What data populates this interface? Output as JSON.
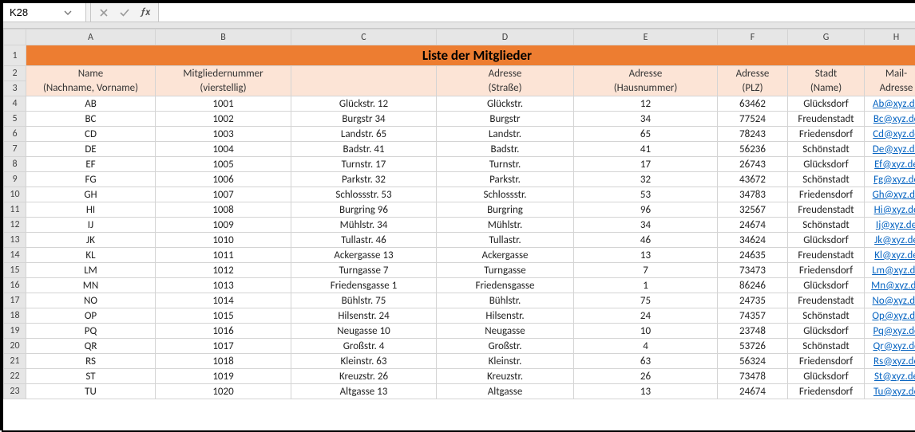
{
  "nameBox": {
    "value": "K28"
  },
  "formulaBar": {
    "value": ""
  },
  "columnLetters": [
    "A",
    "B",
    "C",
    "D",
    "E",
    "F",
    "G",
    "H"
  ],
  "title": "Liste der Mitglieder",
  "headers": {
    "A": {
      "top": "Name",
      "bot": "(Nachname, Vorname)"
    },
    "B": {
      "top": "Mitgliedernummer",
      "bot": "(vierstellig)"
    },
    "C": {
      "top": "",
      "bot": ""
    },
    "D": {
      "top": "Adresse",
      "bot": "(Straße)"
    },
    "E": {
      "top": "Adresse",
      "bot": "(Hausnummer)"
    },
    "F": {
      "top": "Adresse",
      "bot": "(PLZ)"
    },
    "G": {
      "top": "Stadt",
      "bot": "(Name)"
    },
    "H": {
      "top": "Mail-",
      "bot": "Adresse"
    }
  },
  "rows": [
    {
      "n": 4,
      "name": "AB",
      "num": "1001",
      "addr": "Glückstr. 12",
      "street": "Glückstr.",
      "house": "12",
      "plz": "63462",
      "city": "Glücksdorf",
      "mail": "Ab@xyz.de"
    },
    {
      "n": 5,
      "name": "BC",
      "num": "1002",
      "addr": "Burgstr 34",
      "street": "Burgstr",
      "house": "34",
      "plz": "77524",
      "city": "Freudenstadt",
      "mail": "Bc@xyz.de"
    },
    {
      "n": 6,
      "name": "CD",
      "num": "1003",
      "addr": "Landstr. 65",
      "street": "Landstr.",
      "house": "65",
      "plz": "78243",
      "city": "Friedensdorf",
      "mail": "Cd@xyz.de"
    },
    {
      "n": 7,
      "name": "DE",
      "num": "1004",
      "addr": "Badstr. 41",
      "street": "Badstr.",
      "house": "41",
      "plz": "56236",
      "city": "Schönstadt",
      "mail": "De@xyz.de"
    },
    {
      "n": 8,
      "name": "EF",
      "num": "1005",
      "addr": "Turnstr. 17",
      "street": "Turnstr.",
      "house": "17",
      "plz": "26743",
      "city": "Glücksdorf",
      "mail": "Ef@xyz.de"
    },
    {
      "n": 9,
      "name": "FG",
      "num": "1006",
      "addr": "Parkstr. 32",
      "street": "Parkstr.",
      "house": "32",
      "plz": "43672",
      "city": "Schönstadt",
      "mail": "Fg@xyz.de"
    },
    {
      "n": 10,
      "name": "GH",
      "num": "1007",
      "addr": "Schlossstr. 53",
      "street": "Schlossstr.",
      "house": "53",
      "plz": "34783",
      "city": "Friedensdorf",
      "mail": "Gh@xyz.de"
    },
    {
      "n": 11,
      "name": "HI",
      "num": "1008",
      "addr": "Burgring 96",
      "street": "Burgring",
      "house": "96",
      "plz": "32567",
      "city": "Freudenstadt",
      "mail": "Hi@xyz.de"
    },
    {
      "n": 12,
      "name": "IJ",
      "num": "1009",
      "addr": "Mühlstr. 34",
      "street": "Mühlstr.",
      "house": "34",
      "plz": "24674",
      "city": "Schönstadt",
      "mail": "Ij@xyz.de"
    },
    {
      "n": 13,
      "name": "JK",
      "num": "1010",
      "addr": "Tullastr. 46",
      "street": "Tullastr.",
      "house": "46",
      "plz": "34624",
      "city": "Glücksdorf",
      "mail": "Jk@xyz.de"
    },
    {
      "n": 14,
      "name": "KL",
      "num": "1011",
      "addr": "Ackergasse 13",
      "street": "Ackergasse",
      "house": "13",
      "plz": "24635",
      "city": "Freudenstadt",
      "mail": "Kl@xyz.de"
    },
    {
      "n": 15,
      "name": "LM",
      "num": "1012",
      "addr": "Turngasse 7",
      "street": "Turngasse",
      "house": "7",
      "plz": "73473",
      "city": "Friedensdorf",
      "mail": "Lm@xyz.de"
    },
    {
      "n": 16,
      "name": "MN",
      "num": "1013",
      "addr": "Friedensgasse 1",
      "street": "Friedensgasse",
      "house": "1",
      "plz": "86246",
      "city": "Glücksdorf",
      "mail": "Mn@xyz.de"
    },
    {
      "n": 17,
      "name": "NO",
      "num": "1014",
      "addr": "Bühlstr. 75",
      "street": "Bühlstr.",
      "house": "75",
      "plz": "24735",
      "city": "Freudenstadt",
      "mail": "No@xyz.de"
    },
    {
      "n": 18,
      "name": "OP",
      "num": "1015",
      "addr": "Hilsenstr. 24",
      "street": "Hilsenstr.",
      "house": "24",
      "plz": "74357",
      "city": "Schönstadt",
      "mail": "Op@xyz.de"
    },
    {
      "n": 19,
      "name": "PQ",
      "num": "1016",
      "addr": "Neugasse 10",
      "street": "Neugasse",
      "house": "10",
      "plz": "23748",
      "city": "Glücksdorf",
      "mail": "Pq@xyz.de"
    },
    {
      "n": 20,
      "name": "QR",
      "num": "1017",
      "addr": "Großstr. 4",
      "street": "Großstr.",
      "house": "4",
      "plz": "53726",
      "city": "Schönstadt",
      "mail": "Qr@xyz.de"
    },
    {
      "n": 21,
      "name": "RS",
      "num": "1018",
      "addr": "Kleinstr. 63",
      "street": "Kleinstr.",
      "house": "63",
      "plz": "56324",
      "city": "Friedensdorf",
      "mail": "Rs@xyz.de"
    },
    {
      "n": 22,
      "name": "ST",
      "num": "1019",
      "addr": "Kreuzstr. 26",
      "street": "Kreuzstr.",
      "house": "26",
      "plz": "73478",
      "city": "Glücksdorf",
      "mail": "St@xyz.de"
    },
    {
      "n": 23,
      "name": "TU",
      "num": "1020",
      "addr": "Altgasse 13",
      "street": "Altgasse",
      "house": "13",
      "plz": "24674",
      "city": "Friedensdorf",
      "mail": "Tu@xyz.de"
    }
  ]
}
